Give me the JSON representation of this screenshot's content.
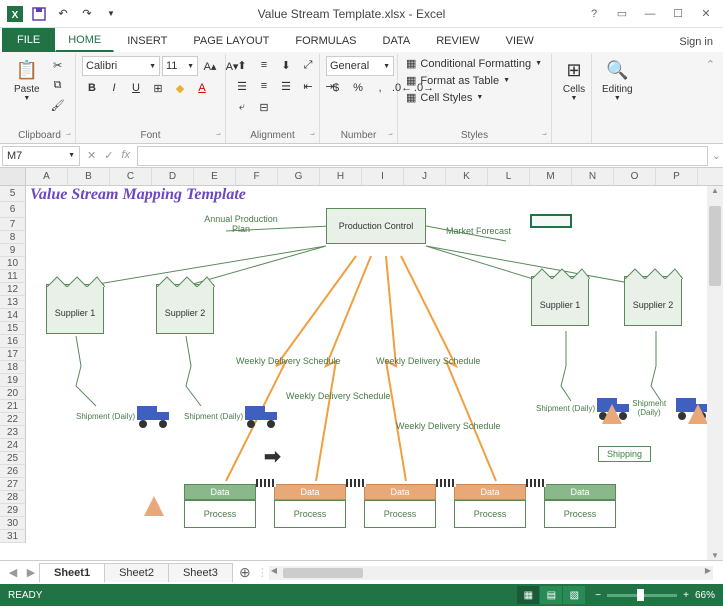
{
  "titlebar": {
    "filename": "Value Stream Template.xlsx",
    "app": "Excel"
  },
  "signin": "Sign in",
  "tabs": [
    "FILE",
    "HOME",
    "INSERT",
    "PAGE LAYOUT",
    "FORMULAS",
    "DATA",
    "REVIEW",
    "VIEW"
  ],
  "ribbon": {
    "clipboard": {
      "label": "Clipboard",
      "paste": "Paste"
    },
    "font": {
      "label": "Font",
      "family": "Calibri",
      "size": "11"
    },
    "alignment": {
      "label": "Alignment"
    },
    "number": {
      "label": "Number",
      "format": "General"
    },
    "styles": {
      "label": "Styles",
      "cond": "Conditional Formatting",
      "table": "Format as Table",
      "cell": "Cell Styles"
    },
    "cells": {
      "label": "Cells"
    },
    "editing": {
      "label": "Editing"
    }
  },
  "namebox": "M7",
  "formula": "",
  "columns": [
    "A",
    "B",
    "C",
    "D",
    "E",
    "F",
    "G",
    "H",
    "I",
    "J",
    "K",
    "L",
    "M",
    "N",
    "O",
    "P"
  ],
  "rows": [
    "5",
    "6",
    "7",
    "8",
    "9",
    "10",
    "11",
    "12",
    "13",
    "14",
    "15",
    "16",
    "17",
    "18",
    "19",
    "20",
    "21",
    "22",
    "23",
    "24",
    "25",
    "26",
    "27",
    "28",
    "29",
    "30",
    "31"
  ],
  "diagram": {
    "title": "Value Stream Mapping Template",
    "prodctrl": "Production Control",
    "annual": "Annual Production Plan",
    "forecast": "Market Forecast",
    "supplier1": "Supplier 1",
    "supplier2": "Supplier 2",
    "weekly": "Weekly Delivery Schedule",
    "shipment": "Shipment (Daily)",
    "shipping": "Shipping",
    "data": "Data",
    "process": "Process"
  },
  "sheets": [
    "Sheet1",
    "Sheet2",
    "Sheet3"
  ],
  "status": "READY",
  "zoom": "66%"
}
